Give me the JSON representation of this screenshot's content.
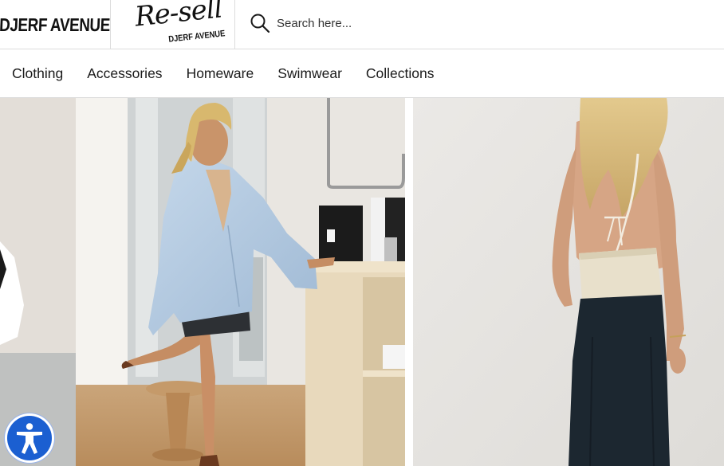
{
  "header": {
    "brand_logo": "DJERF AVENUE",
    "resell_logo": {
      "script": "Re-sell",
      "subtitle": "DJERF AVENUE"
    },
    "search": {
      "placeholder": "Search here...",
      "value": "",
      "icon": "search-icon"
    }
  },
  "nav": {
    "items": [
      {
        "label": "Clothing"
      },
      {
        "label": "Accessories"
      },
      {
        "label": "Homeware"
      },
      {
        "label": "Swimwear"
      },
      {
        "label": "Collections"
      }
    ]
  },
  "products": [
    {
      "image": "woman-in-light-blue-oversized-shirt-in-store"
    },
    {
      "image": "woman-back-view-cream-tie-top-black-skirt"
    }
  ],
  "accessibility_button": {
    "icon": "accessibility-icon",
    "color": "#1b5fd1"
  }
}
